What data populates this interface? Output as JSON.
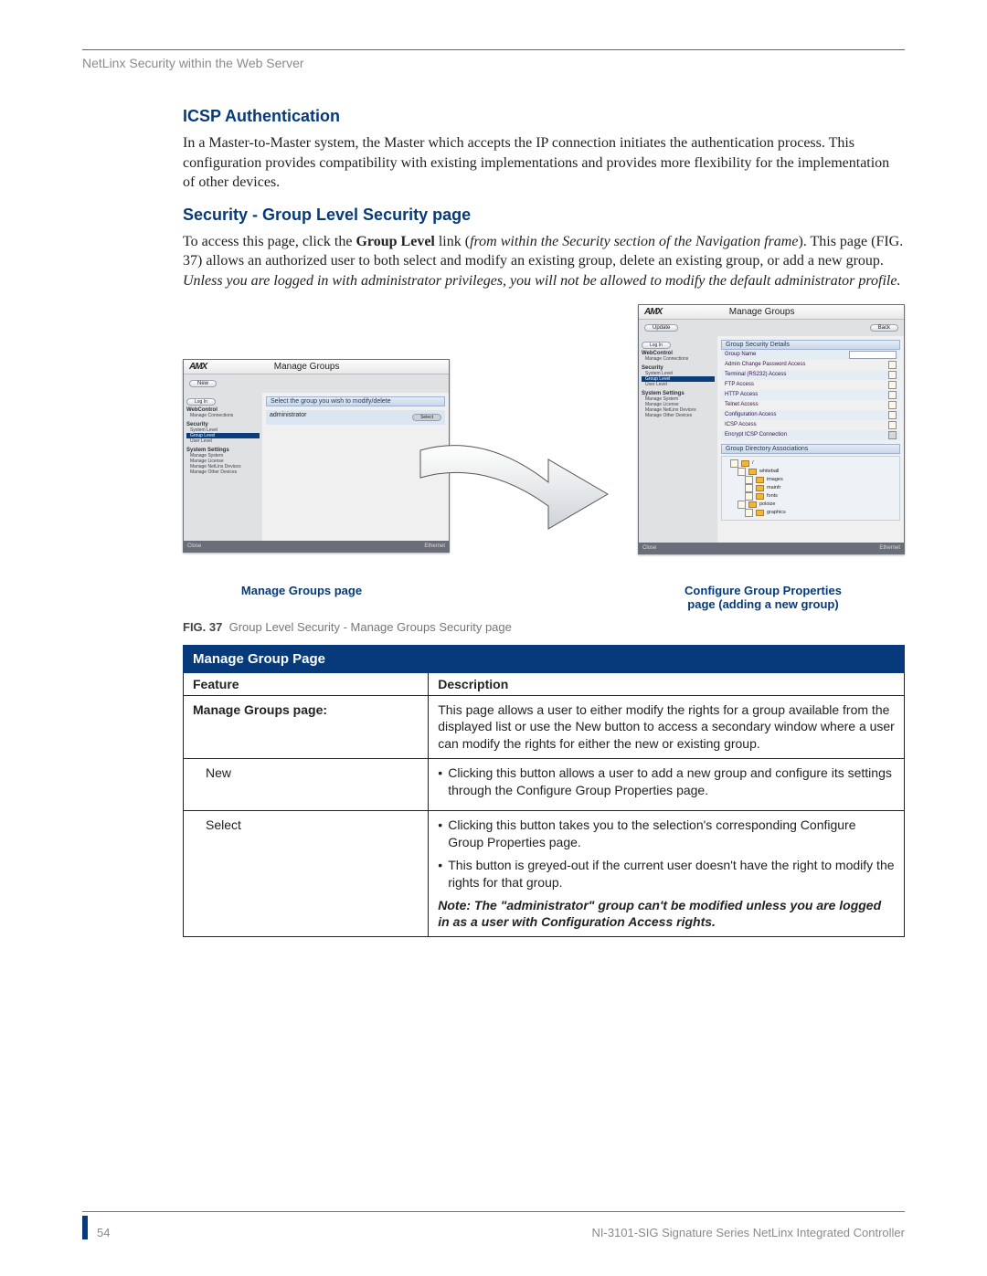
{
  "running_head": "NetLinx Security within the Web Server",
  "h_icsp": "ICSP Authentication",
  "p_icsp": "In a Master-to-Master system, the Master which accepts the IP connection initiates the authentication process. This configuration provides compatibility with existing implementations and provides more flexibility for the implementation of other devices.",
  "h_sec": "Security - Group Level Security page",
  "p_sec_a": "To access this page, click the ",
  "p_sec_b": "Group Level",
  "p_sec_c": " link (",
  "p_sec_d": "from within the Security section of the Navigation frame",
  "p_sec_e": "). This page (FIG. 37) allows an authorized user to both select and modify an existing group, delete an existing group, or add a new group. ",
  "p_sec_f": "Unless you are logged in with administrator privileges, you will not be allowed to modify the default administrator profile.",
  "screenshot": {
    "logo": "AMX",
    "title": "Manage Groups",
    "btn_new": "New",
    "btn_back": "Back",
    "btn_login": "Log In",
    "msg_select": "Select the group you wish to modify/delete",
    "row_user": "administrator",
    "btn_update": "Update",
    "status_close": "Close",
    "status_net": "Ethernet",
    "nav": {
      "webcontrol": "WebControl",
      "wc_item": "Manage Connections",
      "security": "Security",
      "s1": "System Level",
      "s2": "Group Level",
      "s3": "User Level",
      "settings": "System Settings",
      "ss1": "Manage System",
      "ss2": "Manage License",
      "ss3": "Manage NetLinx Devices",
      "ss4": "Manage Other Devices"
    },
    "details": {
      "title": "Group Security Details",
      "r1": "Group Name",
      "r2": "Admin Change Password Access",
      "r3": "Terminal (RS232) Access",
      "r4": "FTP Access",
      "r5": "HTTP Access",
      "r6": "Telnet Access",
      "r7": "Configuration Access",
      "r8": "ICSP Access",
      "r9": "Encrypt ICSP Connection",
      "dir_title": "Group Directory Associations",
      "tree": {
        "root": "/",
        "a": "whiteball",
        "b": "images",
        "c": "mainfr",
        "d": "fonts",
        "e": "poloize",
        "f": "graphics"
      }
    }
  },
  "cap_left": "Manage Groups page",
  "cap_right_1": "Configure Group Properties",
  "cap_right_2": "page (adding a new group)",
  "fig_label": "FIG. 37",
  "fig_text": "Group Level Security - Manage Groups Security page",
  "table": {
    "title": "Manage Group Page",
    "col1": "Feature",
    "col2": "Description",
    "row1_f": "Manage Groups page:",
    "row1_d": "This page allows a user to either modify the rights for a group available from the displayed list or use the New button to access a secondary window where a user can modify the rights for either the new or existing group.",
    "row2_f": "New",
    "row2_d": "Clicking this button allows a user to add a new group and configure its settings through the Configure Group Properties page.",
    "row3_f": "Select",
    "row3_d1": "Clicking this button takes you to the selection's corresponding Configure Group Properties page.",
    "row3_d2": "This button is greyed-out if the current user doesn't have the right to modify the rights for that group.",
    "row3_note": "Note: The \"administrator\" group can't be modified unless you are logged in as a user with Configuration Access rights."
  },
  "footer": {
    "page": "54",
    "manual": "NI-3101-SIG Signature Series NetLinx Integrated Controller"
  }
}
